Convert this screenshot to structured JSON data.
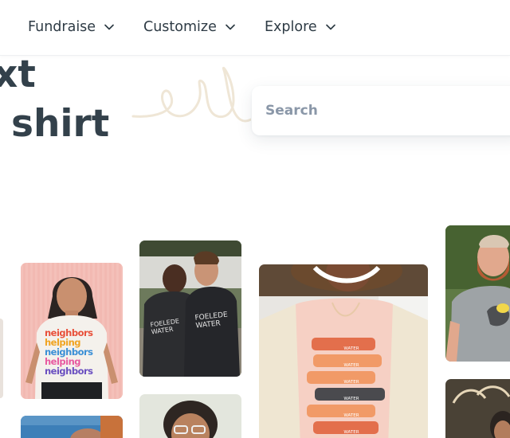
{
  "nav": {
    "items": [
      {
        "label": "Fundraise"
      },
      {
        "label": "Customize"
      },
      {
        "label": "Explore"
      }
    ]
  },
  "hero": {
    "line1": "xt",
    "line2": "shirt"
  },
  "search": {
    "placeholder": "Search"
  },
  "colors": {
    "heading": "#33414b",
    "nav_text": "#2e3b45",
    "search_placeholder": "#8a97a8",
    "squiggle": "#efe6d6"
  },
  "gallery": {
    "shirt_texts": {
      "neighbors": [
        "neighbors",
        "helping",
        "neighbors",
        "helping",
        "neighbors"
      ],
      "shirt_a": "FOELEDE WATER",
      "shirt_b": "FOELEDE WATER",
      "water": [
        "WATER",
        "WATER",
        "WATER",
        "WATER",
        "WATER",
        "WATER"
      ]
    }
  }
}
